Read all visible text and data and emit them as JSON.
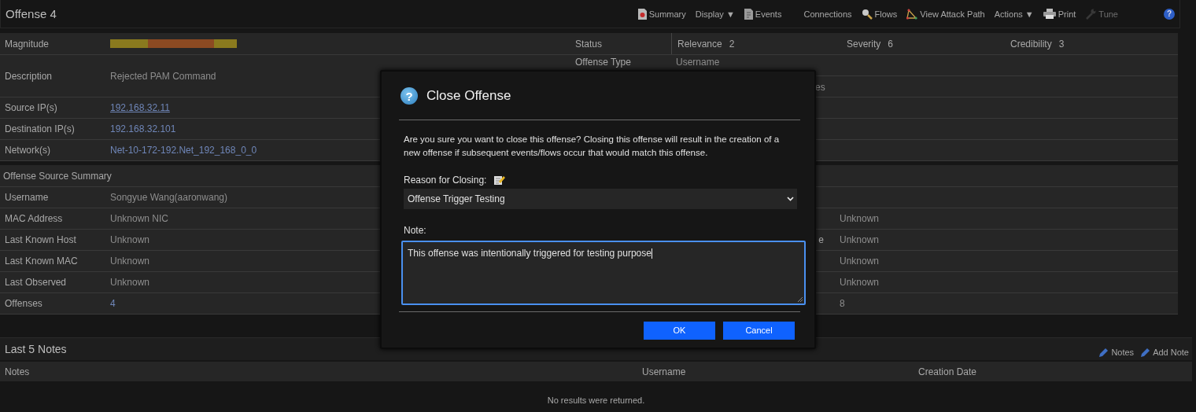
{
  "header": {
    "title": "Offense 4",
    "toolbar": [
      {
        "label": "Summary",
        "disabled": false
      },
      {
        "label": "Display",
        "caret": "▼",
        "disabled": false
      },
      {
        "label": "Events",
        "disabled": false
      },
      {
        "label": "Connections",
        "disabled": false
      },
      {
        "label": "Flows",
        "disabled": false
      },
      {
        "label": "View Attack Path",
        "disabled": false
      },
      {
        "label": "Actions",
        "caret": "▼",
        "disabled": false
      },
      {
        "label": "Print",
        "disabled": false
      },
      {
        "label": "Tune",
        "disabled": true
      }
    ],
    "help": "?"
  },
  "summary": {
    "magnitude": {
      "label": "Magnitude"
    },
    "status": {
      "label": "Status"
    },
    "ratings": [
      {
        "label": "Relevance",
        "value": "2"
      },
      {
        "label": "Severity",
        "value": "6"
      },
      {
        "label": "Credibility",
        "value": "3"
      }
    ],
    "description": {
      "label": "Description",
      "value": "Rejected PAM Command"
    },
    "offense_type": {
      "label": "Offense Type",
      "value": "Username"
    },
    "fragment": "es",
    "ips": [
      {
        "label": "Source IP(s)",
        "value": "192.168.32.11",
        "underlined": true
      },
      {
        "label": "Destination IP(s)",
        "value": "192.168.32.101",
        "underlined": false
      },
      {
        "label": "Network(s)",
        "value": "Net-10-172-192.Net_192_168_0_0",
        "underlined": false
      }
    ]
  },
  "source_summary": {
    "title": "Offense Source Summary",
    "rows": [
      {
        "label": "Username",
        "value": "Songyue Wang(aaronwang)",
        "kind": "text"
      },
      {
        "label": "MAC Address",
        "value": "Unknown NIC",
        "kind": "text",
        "right_value": "Unknown"
      },
      {
        "label": "Last Known Host",
        "value": "Unknown",
        "kind": "text",
        "right_label": "e",
        "right_value": "Unknown"
      },
      {
        "label": "Last Known MAC",
        "value": "Unknown",
        "kind": "text",
        "right_value": "Unknown"
      },
      {
        "label": "Last Observed",
        "value": "Unknown",
        "kind": "text",
        "right_value": "Unknown"
      },
      {
        "label": "Offenses",
        "value": "4",
        "kind": "link",
        "right_value": "8"
      }
    ]
  },
  "notes": {
    "title": "Last 5 Notes",
    "actions": [
      "Notes",
      "Add Note"
    ],
    "columns": [
      "Notes",
      "Username",
      "Creation Date"
    ],
    "empty": "No results were returned."
  },
  "dialog": {
    "icon": "?",
    "title": "Close Offense",
    "message": "Are you sure you want to close this offense? Closing this offense will result in the creation of a new offense if subsequent events/flows occur that would match this offense.",
    "reason_label": "Reason for Closing:",
    "reason": "Offense Trigger Testing",
    "note_label": "Note:",
    "note": "This offense was intentionally triggered for testing purpose",
    "note_focused": true,
    "buttons": [
      "OK",
      "Cancel"
    ]
  }
}
